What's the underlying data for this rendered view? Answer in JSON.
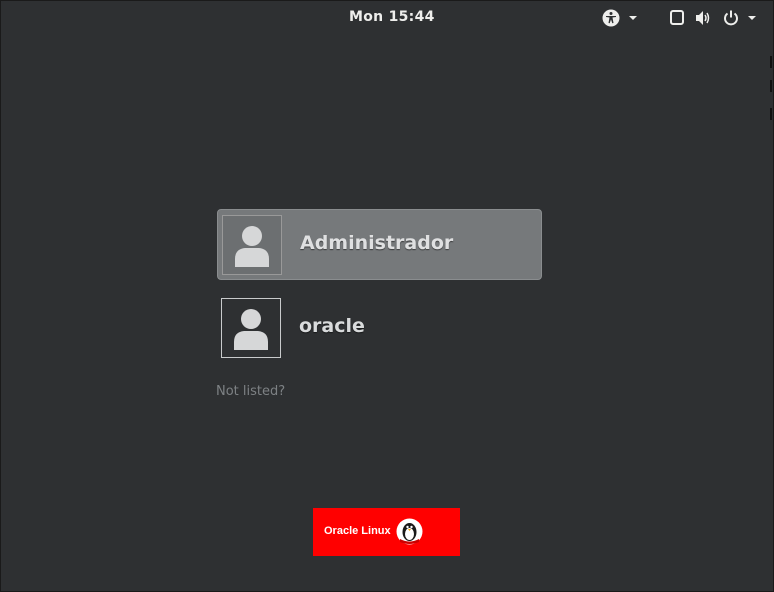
{
  "topbar": {
    "clock": "Mon 15:44",
    "icons": [
      "accessibility-icon",
      "chevron-down-icon",
      "window-icon",
      "volume-icon",
      "power-icon",
      "chevron-down-icon"
    ]
  },
  "users": [
    {
      "name": "Administrador",
      "selected": true,
      "avatar_icon": "user-avatar-icon"
    },
    {
      "name": "oracle",
      "selected": false,
      "avatar_icon": "user-avatar-icon"
    }
  ],
  "not_listed": "Not listed?",
  "branding": {
    "text": "Oracle Linux",
    "logo_icon": "tux-penguin-icon",
    "color": "#ff0000"
  },
  "colors": {
    "background": "#2e3032",
    "selected_row": "#76797b",
    "text": "#eeeeec",
    "muted_text": "#7d8184"
  }
}
